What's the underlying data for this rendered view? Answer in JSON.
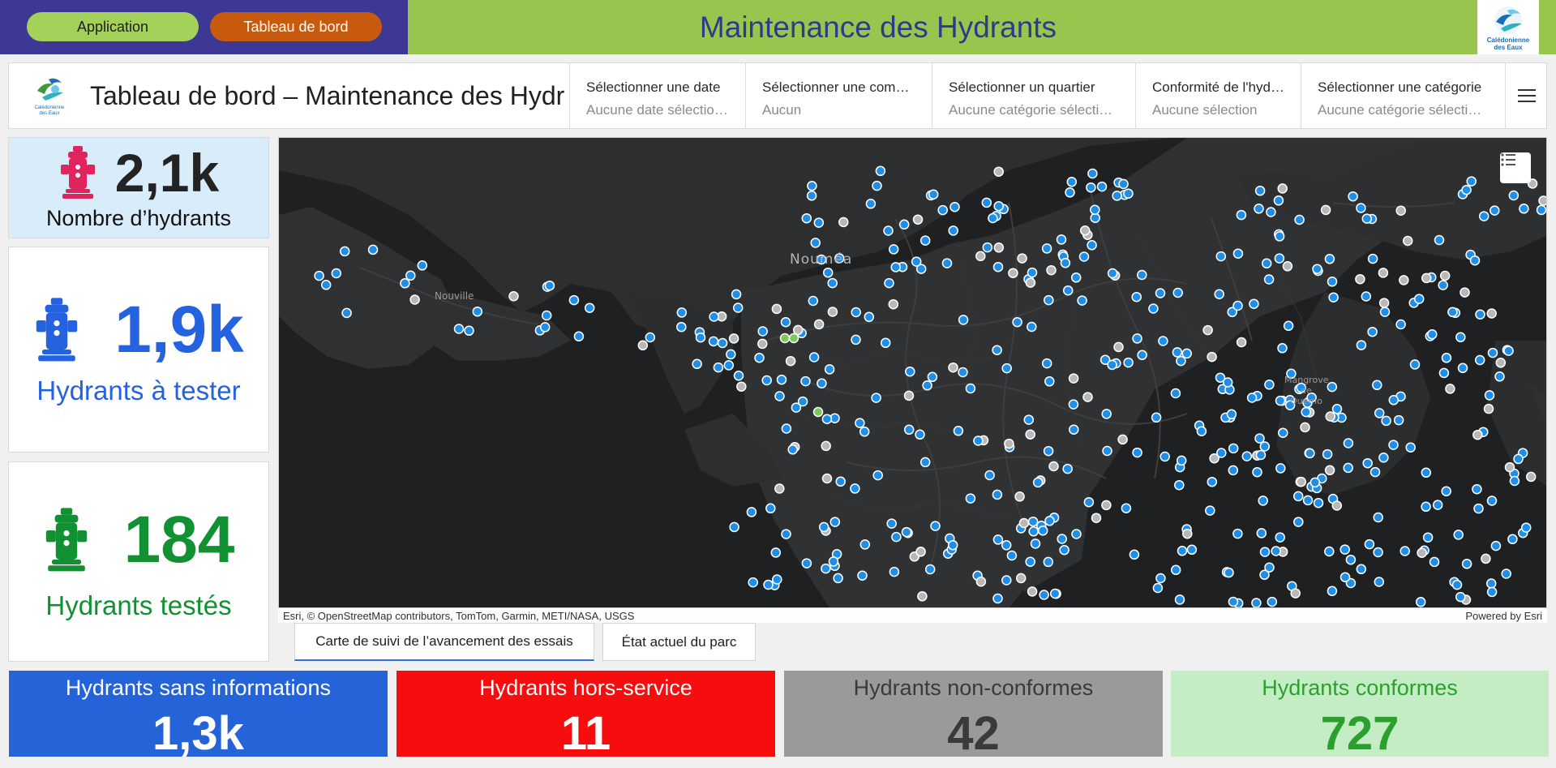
{
  "banner": {
    "app_button": "Application",
    "dashboard_button": "Tableau de bord",
    "title": "Maintenance des Hydrants",
    "logo_text_line1": "Calédonienne",
    "logo_text_line2": "des Eaux"
  },
  "header": {
    "title": "Tableau de bord – Maintenance des Hydrants",
    "filters": [
      {
        "label": "Sélectionner une date",
        "value": "Aucune date sélectionnée"
      },
      {
        "label": "Sélectionner une commune",
        "value": "Aucun"
      },
      {
        "label": "Sélectionner un quartier",
        "value": "Aucune catégorie sélectionnée"
      },
      {
        "label": "Conformité de l'hydrant",
        "value": "Aucune sélection"
      },
      {
        "label": "Sélectionner une catégorie",
        "value": "Aucune catégorie sélectionnée"
      }
    ]
  },
  "kpis": [
    {
      "value": "2,1k",
      "label": "Nombre d’hydrants",
      "color": "#e0245e"
    },
    {
      "value": "1,9k",
      "label": "Hydrants à tester",
      "color": "#2462e0"
    },
    {
      "value": "184",
      "label": "Hydrants testés",
      "color": "#129132"
    }
  ],
  "map": {
    "labels": {
      "city": "Nouméa",
      "district": "Nouville",
      "mangrove_1": "Mangrove",
      "mangrove_2": "de",
      "mangrove_3": "Ouémo"
    },
    "attribution": "Esri, © OpenStreetMap contributors, TomTom, Garmin, METI/NASA, USGS",
    "powered_by": "Powered by Esri",
    "marker_colors": {
      "to_test": "#1f8ee8",
      "no_info": "#b8b8b8",
      "tested": "#7dc85a"
    }
  },
  "tabs": [
    {
      "label": "Carte de suivi de l’avancement des essais"
    },
    {
      "label": "État actuel du parc"
    }
  ],
  "stats": [
    {
      "label": "Hydrants sans informations",
      "value": "1,3k"
    },
    {
      "label": "Hydrants hors-service",
      "value": "11"
    },
    {
      "label": "Hydrants non-conformes",
      "value": "42"
    },
    {
      "label": "Hydrants conformes",
      "value": "727"
    }
  ]
}
